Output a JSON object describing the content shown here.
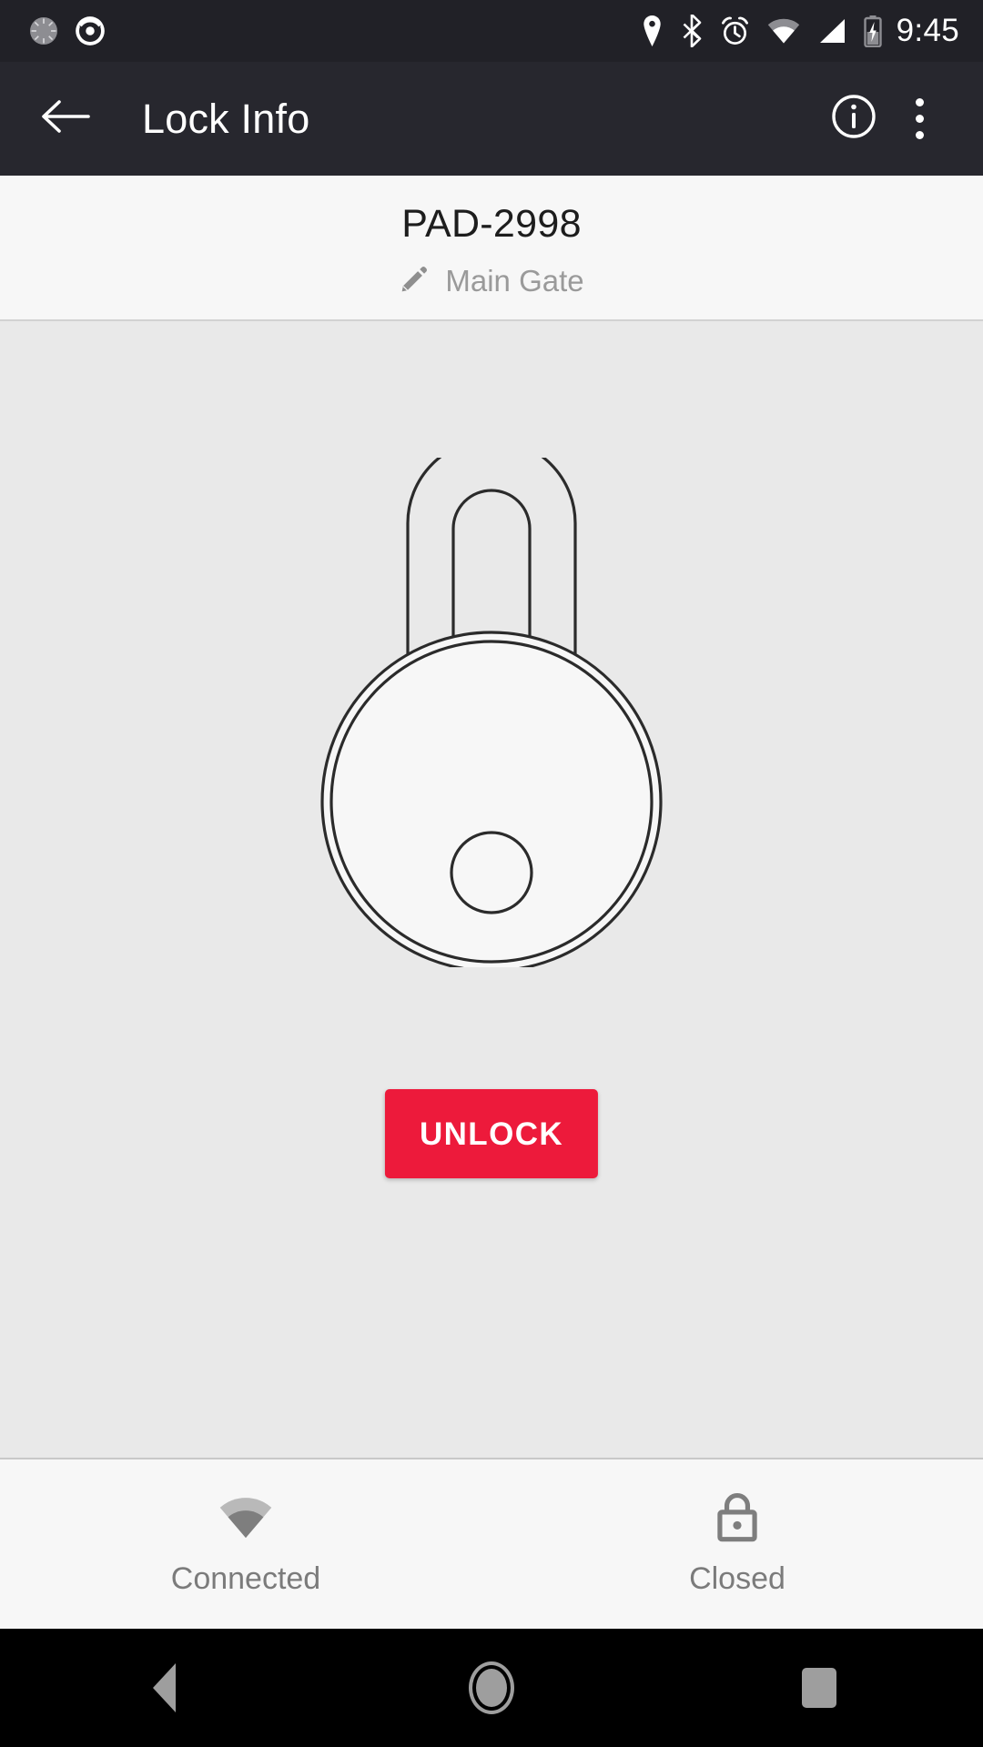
{
  "status_bar": {
    "time": "9:45",
    "notification_icons": [
      "settings-gear-icon",
      "radar-target-icon"
    ],
    "system_icons": [
      "location-icon",
      "bluetooth-icon",
      "alarm-icon",
      "wifi-icon",
      "cell-signal-icon",
      "battery-charging-icon"
    ]
  },
  "app_bar": {
    "title": "Lock Info",
    "back_icon": "arrow-back-icon",
    "info_icon": "info-circle-icon",
    "overflow_icon": "overflow-menu-icon"
  },
  "device_header": {
    "name": "PAD-2998",
    "nickname": "Main Gate",
    "edit_icon": "pencil-edit-icon"
  },
  "lock_stage": {
    "graphic": "padlock-illustration",
    "unlock_label": "UNLOCK",
    "unlock_color": "#ed1a3b",
    "background_color": "#e9e9e9"
  },
  "bottom_status": {
    "connection": {
      "icon": "wifi-signal-icon",
      "label": "Connected"
    },
    "lock_state": {
      "icon": "padlock-closed-icon",
      "label": "Closed"
    }
  },
  "nav_bar": {
    "back": "nav-back-icon",
    "home": "nav-home-icon",
    "recents": "nav-recents-icon"
  }
}
